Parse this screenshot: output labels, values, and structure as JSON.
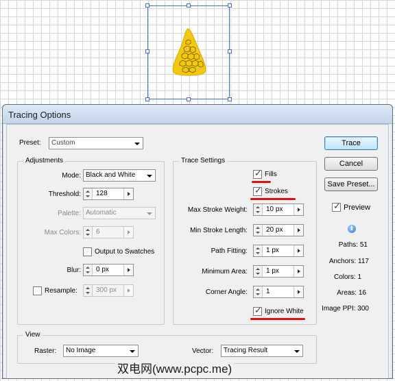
{
  "dialog": {
    "title": "Tracing Options",
    "preset": {
      "label": "Preset:",
      "value": "Custom"
    },
    "adjustments": {
      "title": "Adjustments",
      "mode": {
        "label": "Mode:",
        "value": "Black and White"
      },
      "threshold": {
        "label": "Threshold:",
        "value": "128"
      },
      "palette": {
        "label": "Palette:",
        "value": "Automatic"
      },
      "max_colors": {
        "label": "Max Colors:",
        "value": "6"
      },
      "output_to_swatches": {
        "label": "Output to Swatches",
        "checked": false
      },
      "blur": {
        "label": "Blur:",
        "value": "0 px"
      },
      "resample": {
        "label": "Resample:",
        "value": "300 px",
        "checked": false
      }
    },
    "trace_settings": {
      "title": "Trace Settings",
      "fills": {
        "label": "Fills",
        "checked": true
      },
      "strokes": {
        "label": "Strokes",
        "checked": true
      },
      "max_stroke_weight": {
        "label": "Max Stroke Weight:",
        "value": "10 px"
      },
      "min_stroke_length": {
        "label": "Min Stroke Length:",
        "value": "20 px"
      },
      "path_fitting": {
        "label": "Path Fitting:",
        "value": "1 px"
      },
      "minimum_area": {
        "label": "Minimum Area:",
        "value": "1 px"
      },
      "corner_angle": {
        "label": "Corner Angle:",
        "value": "1"
      },
      "ignore_white": {
        "label": "Ignore White",
        "checked": true
      }
    },
    "view": {
      "title": "View",
      "raster": {
        "label": "Raster:",
        "value": "No Image"
      },
      "vector": {
        "label": "Vector:",
        "value": "Tracing Result"
      }
    },
    "buttons": {
      "trace": "Trace",
      "cancel": "Cancel",
      "save_preset": "Save Preset..."
    },
    "preview": {
      "label": "Preview",
      "checked": true
    },
    "stats": {
      "paths": "Paths: 51",
      "anchors": "Anchors: 117",
      "colors": "Colors: 1",
      "areas": "Areas: 16",
      "image_ppi": "Image PPI: 300"
    }
  },
  "watermark": "双电网(www.pcpc.me)",
  "colors": {
    "accent_underline": "#e01010",
    "selection": "#4a6bd1",
    "corn_fill": "#f2c811"
  }
}
